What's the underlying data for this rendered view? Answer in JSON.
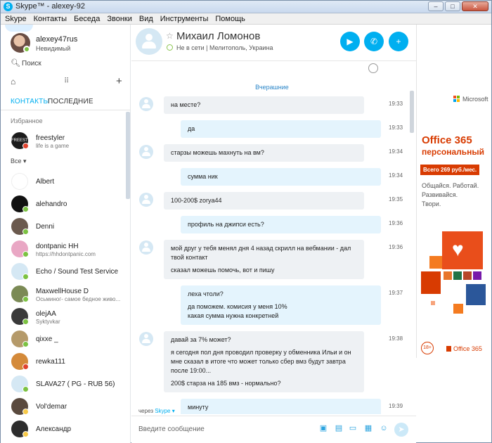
{
  "window": {
    "title": "Skype™ - alexey-92",
    "logo": "S",
    "min": "–",
    "max": "□",
    "close": "✕"
  },
  "menu": [
    "Skype",
    "Контакты",
    "Беседа",
    "Звонки",
    "Вид",
    "Инструменты",
    "Помощь"
  ],
  "me": {
    "name": "alexey47rus",
    "mood": "Невидимый"
  },
  "search": {
    "label": "Поиск",
    "icon": "search-icon"
  },
  "tabs": {
    "contacts": "КОНТАКТЫ",
    "recent": "ПОСЛЕДНИЕ"
  },
  "sections": {
    "favorites": "Избранное",
    "all": "Все ▾"
  },
  "favorites": [
    {
      "name": "freestyler",
      "mood": "life is a game",
      "status": "dnd",
      "avatar_color": "#1b1b1b",
      "avatar_text": "FREESTY"
    }
  ],
  "contacts": [
    {
      "name": "Albert",
      "mood": "",
      "status": "",
      "avatar_color": "#ffffff"
    },
    {
      "name": "alehandro",
      "mood": "",
      "status": "online",
      "avatar_color": "#111111"
    },
    {
      "name": "Denni",
      "mood": "",
      "status": "online",
      "avatar_color": "#6b5a4e"
    },
    {
      "name": "dontpanic HH",
      "mood": "https://hhdontpanic.com",
      "status": "online",
      "avatar_color": "#e9a7c4"
    },
    {
      "name": "Echo / Sound Test Service",
      "mood": "",
      "status": "online",
      "avatar_color": "#d5e8f4"
    },
    {
      "name": "MaxwellHouse D",
      "mood": "Осьминог- самое бедное живо...",
      "status": "online",
      "avatar_color": "#7b8a55"
    },
    {
      "name": "olejAA",
      "mood": "Syktyvkar",
      "status": "online",
      "avatar_color": "#3a3a3a"
    },
    {
      "name": "qixxe _",
      "mood": "",
      "status": "online",
      "avatar_color": "#b59a6a"
    },
    {
      "name": "rewka111",
      "mood": "",
      "status": "dnd",
      "avatar_color": "#d48a3a"
    },
    {
      "name": "SLAVA27 ( PG - RUB 56)",
      "mood": "",
      "status": "online",
      "avatar_color": "#d5e8f4"
    },
    {
      "name": "Vol'demar",
      "mood": "",
      "status": "away",
      "avatar_color": "#5a4a3e"
    },
    {
      "name": "Александр",
      "mood": "",
      "status": "away",
      "avatar_color": "#2d2d2d"
    }
  ],
  "chat": {
    "name": "Михаил Ломонов",
    "status": "Не в сети",
    "location": "Мелитополь, Украина",
    "day": "Вчерашние",
    "via_prefix": "через",
    "via_service": "Skype ▾",
    "placeholder": "Введите сообщение",
    "send_icon": "➤"
  },
  "messages": [
    {
      "dir": "in",
      "time": "19:33",
      "lines": [
        "на месте?"
      ]
    },
    {
      "dir": "out",
      "time": "19:33",
      "lines": [
        "да"
      ]
    },
    {
      "dir": "in",
      "time": "19:34",
      "lines": [
        "старзы можешь махнуть на вм?"
      ]
    },
    {
      "dir": "out",
      "time": "19:34",
      "lines": [
        "сумма ник"
      ]
    },
    {
      "dir": "in",
      "time": "19:35",
      "lines": [
        "100-200$ zorya44"
      ]
    },
    {
      "dir": "out",
      "time": "19:36",
      "lines": [
        "профиль на джипси есть?"
      ]
    },
    {
      "dir": "in",
      "time": "19:36",
      "lines": [
        "мой друг у тебя менял дня 4 назад скрилл на вебмании - дал",
        "твой контакт",
        "",
        "сказал можешь помочь, вот и пишу"
      ]
    },
    {
      "dir": "out",
      "time": "19:37",
      "lines": [
        "леха чтоли?",
        "",
        "да поможем. комисия у меня 10%",
        "какая сумма нужна конкретней"
      ]
    },
    {
      "dir": "in",
      "time": "19:38",
      "lines": [
        "давай за 7% может?",
        "",
        "я сегодня пол дня проводил проверку у обменника Ильи и он",
        "мне сказал в итоге что может только сбер вмз будут завтра",
        "после 19:00...",
        "",
        "200$  старза на 185 вмз - нормально?"
      ]
    },
    {
      "dir": "out",
      "time": "19:39",
      "lines": [
        "минуту"
      ]
    }
  ],
  "ad": {
    "brand": "Microsoft",
    "product": "Office 365",
    "edition": "персональный",
    "price": "Всего 269 руб./мес.",
    "taglines": [
      "Общайся. Работай.",
      "Развивайся.",
      "Твори."
    ],
    "age": "18+",
    "footer": "Office 365",
    "colors": {
      "accent": "#d83b01",
      "skype_blue": "#00aff0"
    }
  }
}
